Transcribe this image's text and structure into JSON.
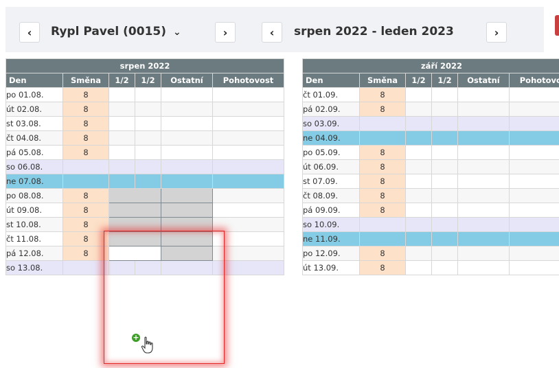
{
  "toolbar": {
    "prev_person": "‹",
    "person_name": "Rypl Pavel (0015)",
    "person_dropdown": "⌄",
    "next_person": "›",
    "prev_period": "‹",
    "period": "srpen 2022 - leden 2023",
    "next_period": "›"
  },
  "columns": [
    "Den",
    "Směna",
    "1/2",
    "1/2",
    "Ostatní",
    "Pohotovost"
  ],
  "months": [
    {
      "title": "srpen 2022",
      "rows": [
        {
          "day": "po 01.08.",
          "shift": "8",
          "type": "work"
        },
        {
          "day": "út 02.08.",
          "shift": "8",
          "type": "work"
        },
        {
          "day": "st 03.08.",
          "shift": "8",
          "type": "work"
        },
        {
          "day": "čt 04.08.",
          "shift": "8",
          "type": "work"
        },
        {
          "day": "pá 05.08.",
          "shift": "8",
          "type": "work"
        },
        {
          "day": "so 06.08.",
          "shift": "",
          "type": "sat"
        },
        {
          "day": "ne 07.08.",
          "shift": "",
          "type": "sun"
        },
        {
          "day": "po 08.08.",
          "shift": "8",
          "type": "work"
        },
        {
          "day": "út 09.08.",
          "shift": "8",
          "type": "work"
        },
        {
          "day": "st 10.08.",
          "shift": "8",
          "type": "work"
        },
        {
          "day": "čt 11.08.",
          "shift": "8",
          "type": "work"
        },
        {
          "day": "pá 12.08.",
          "shift": "8",
          "type": "work"
        },
        {
          "day": "so 13.08.",
          "shift": "",
          "type": "sat"
        }
      ]
    },
    {
      "title": "září 2022",
      "rows": [
        {
          "day": "čt 01.09.",
          "shift": "8",
          "type": "work"
        },
        {
          "day": "pá 02.09.",
          "shift": "8",
          "type": "work"
        },
        {
          "day": "so 03.09.",
          "shift": "",
          "type": "sat"
        },
        {
          "day": "ne 04.09.",
          "shift": "",
          "type": "sun"
        },
        {
          "day": "po 05.09.",
          "shift": "8",
          "type": "work"
        },
        {
          "day": "út 06.09.",
          "shift": "8",
          "type": "work"
        },
        {
          "day": "st 07.09.",
          "shift": "8",
          "type": "work"
        },
        {
          "day": "čt 08.09.",
          "shift": "8",
          "type": "work"
        },
        {
          "day": "pá 09.09.",
          "shift": "8",
          "type": "work"
        },
        {
          "day": "so 10.09.",
          "shift": "",
          "type": "sat"
        },
        {
          "day": "ne 11.09.",
          "shift": "",
          "type": "sun"
        },
        {
          "day": "po 12.09.",
          "shift": "8",
          "type": "work"
        },
        {
          "day": "út 13.09.",
          "shift": "8",
          "type": "work"
        }
      ]
    }
  ],
  "selection": {
    "month": 0,
    "from_row": 7,
    "to_row": 11,
    "active_row": 11
  },
  "icons": {
    "add": "plus-circle-icon",
    "cursor": "hand-pointer-icon"
  },
  "colors": {
    "header": "#6b7b80",
    "shift_cell": "#fde1c9",
    "saturday": "#e6e6f8",
    "sunday": "#84cce6",
    "selection": "#d3d3d3",
    "highlight": "#e52929",
    "add_icon": "#3f9d2a"
  }
}
